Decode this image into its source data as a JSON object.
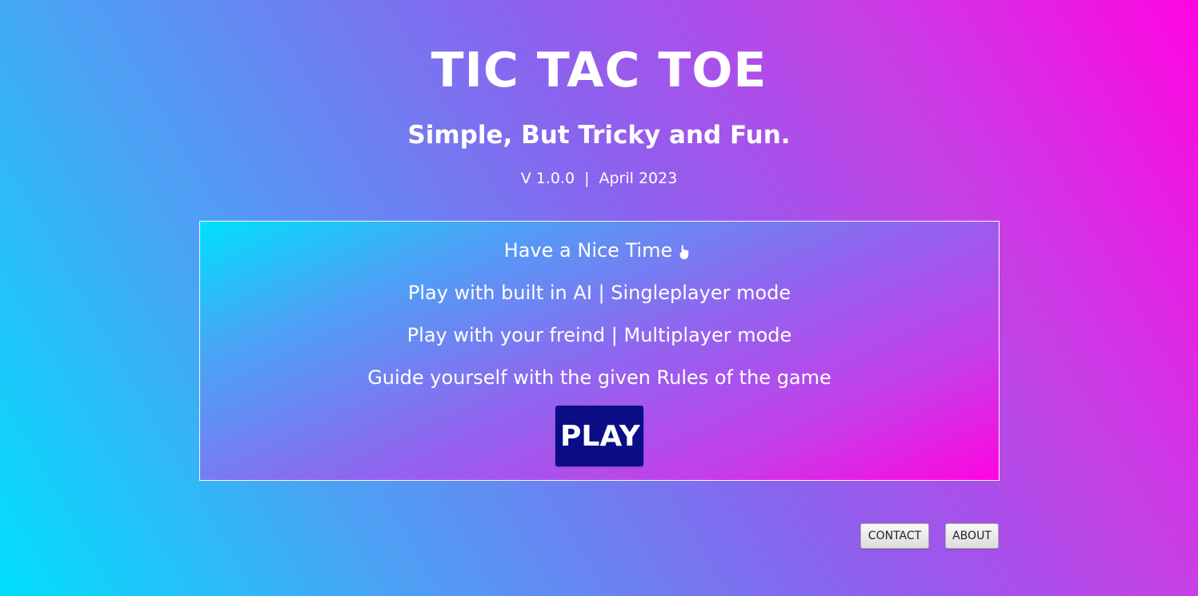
{
  "header": {
    "title": "TIC TAC TOE",
    "subtitle": "Simple, But Tricky and Fun.",
    "version": "V 1.0.0",
    "version_separator": "|",
    "date": "April 2023"
  },
  "panel": {
    "greeting": "Have a Nice Time",
    "greeting_icon": "pointing-hand-icon",
    "lines": [
      "Play with built in AI | Singleplayer mode",
      "Play with your freind | Multiplayer mode",
      "Guide yourself with the given Rules of the game"
    ],
    "play_label": "PLAY"
  },
  "footer": {
    "contact_label": "CONTACT",
    "about_label": "ABOUT"
  },
  "colors": {
    "gradient_start": "#00dffc",
    "gradient_mid": "#8a63ee",
    "gradient_end": "#ff05e1",
    "play_button": "#0a0d84",
    "text": "#ffffff"
  }
}
